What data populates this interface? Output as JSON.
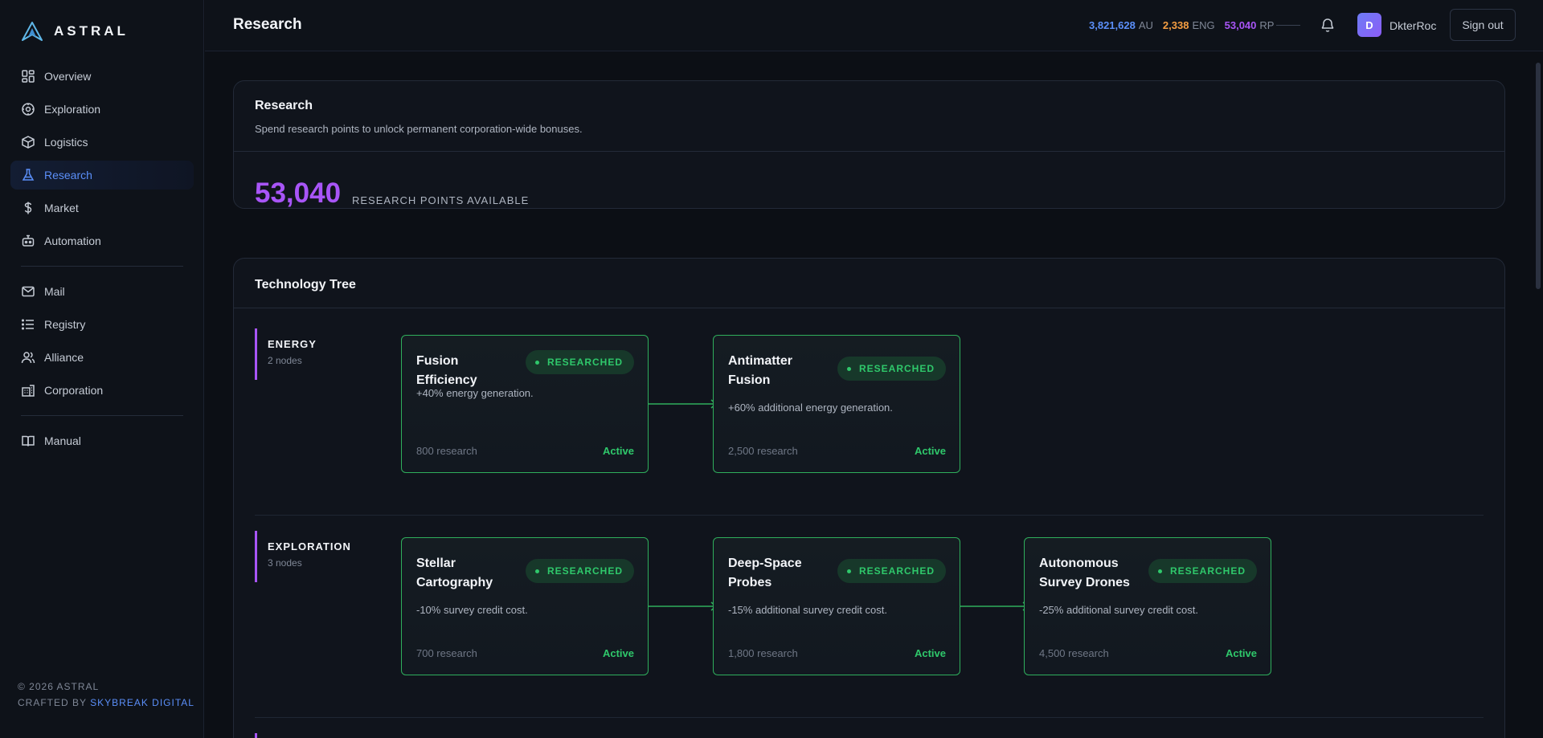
{
  "brand": {
    "name": "ASTRAL"
  },
  "sidebar": {
    "items": [
      {
        "label": "Overview",
        "icon": "grid-icon"
      },
      {
        "label": "Exploration",
        "icon": "compass-icon"
      },
      {
        "label": "Logistics",
        "icon": "package-icon"
      },
      {
        "label": "Research",
        "icon": "flask-icon",
        "active": true
      },
      {
        "label": "Market",
        "icon": "dollar-icon"
      },
      {
        "label": "Automation",
        "icon": "bot-icon"
      },
      {
        "label": "Mail",
        "icon": "mail-icon"
      },
      {
        "label": "Registry",
        "icon": "list-icon"
      },
      {
        "label": "Alliance",
        "icon": "users-icon"
      },
      {
        "label": "Corporation",
        "icon": "building-icon"
      },
      {
        "label": "Manual",
        "icon": "book-icon"
      }
    ],
    "footer": {
      "copyright": "© 2026 ASTRAL",
      "crafted_prefix": "CRAFTED BY",
      "studio": "SKYBREAK DIGITAL"
    }
  },
  "header": {
    "title": "Research",
    "resources": {
      "au": {
        "value": "3,821,628",
        "unit": "AU"
      },
      "eng": {
        "value": "2,338",
        "unit": "ENG"
      },
      "rp": {
        "value": "53,040",
        "unit": "RP"
      }
    },
    "user": {
      "initial": "D",
      "name": "DkterRoc"
    },
    "signout_label": "Sign out"
  },
  "research_card": {
    "title": "Research",
    "subtitle": "Spend research points to unlock permanent corporation-wide bonuses.",
    "points": "53,040",
    "points_label": "RESEARCH POINTS AVAILABLE"
  },
  "tech_tree": {
    "title": "Technology Tree",
    "branches": [
      {
        "name": "ENERGY",
        "count": "2 nodes",
        "nodes": [
          {
            "name": "Fusion Efficiency",
            "badge": "RESEARCHED",
            "desc": "+40% energy generation.",
            "cost": "800 research",
            "status": "Active"
          },
          {
            "name": "Antimatter Fusion",
            "badge": "RESEARCHED",
            "desc": "+60% additional energy generation.",
            "cost": "2,500 research",
            "status": "Active"
          }
        ]
      },
      {
        "name": "EXPLORATION",
        "count": "3 nodes",
        "nodes": [
          {
            "name": "Stellar Cartography",
            "badge": "RESEARCHED",
            "desc": "-10% survey credit cost.",
            "cost": "700 research",
            "status": "Active"
          },
          {
            "name": "Deep-Space Probes",
            "badge": "RESEARCHED",
            "desc": "-15% additional survey credit cost.",
            "cost": "1,800 research",
            "status": "Active"
          },
          {
            "name": "Autonomous Survey Drones",
            "badge": "RESEARCHED",
            "desc": "-25% additional survey credit cost.",
            "cost": "4,500 research",
            "status": "Active"
          }
        ]
      }
    ]
  },
  "colors": {
    "accent_blue": "#5b8ff9",
    "accent_purple": "#a855f7",
    "accent_orange": "#f59e42",
    "researched_green": "#2fc86b"
  }
}
